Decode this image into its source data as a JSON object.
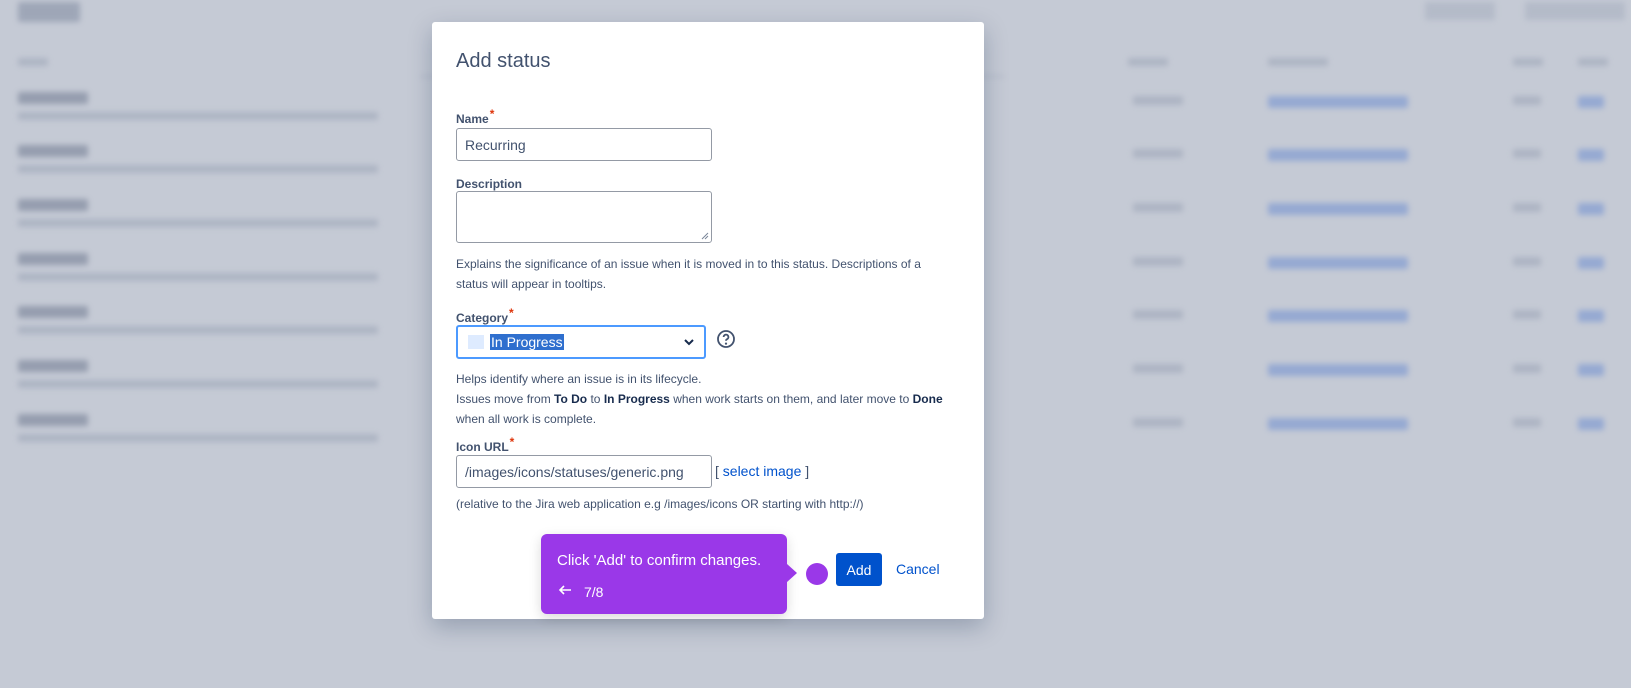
{
  "modal": {
    "title": "Add status",
    "name_label": "Name",
    "name_value": "Recurring",
    "description_label": "Description",
    "description_value": "",
    "description_help_line1": "Explains the significance of an issue when it is moved in to this status. Descriptions of a",
    "description_help_line2": "status will appear in tooltips.",
    "category_label": "Category",
    "category_value": "In Progress",
    "category_help": {
      "line1": "Helps identify where an issue is in its lifecycle.",
      "p1": "Issues move from ",
      "b1": "To Do",
      "p2": " to ",
      "b2": "In Progress",
      "p3": " when work starts on them, and later move to ",
      "b3": "Done",
      "line3": "when all work is complete."
    },
    "icon_url_label": "Icon URL",
    "icon_url_value": "/images/icons/statuses/generic.png",
    "select_image_open": "[ ",
    "select_image_link": "select image",
    "select_image_close": " ]",
    "icon_url_help": "(relative to the Jira web application e.g /images/icons OR starting with http://)",
    "add_button": "Add",
    "cancel_link": "Cancel",
    "required_marker": "*"
  },
  "tooltip": {
    "message": "Click 'Add' to confirm changes.",
    "step": "7/8",
    "back_icon": "arrow-left-icon",
    "color": "#9a38e8"
  },
  "colors": {
    "primary": "#0052cc",
    "focus": "#4c9aff",
    "required": "#de350b",
    "overlay": "#c5cad5"
  }
}
